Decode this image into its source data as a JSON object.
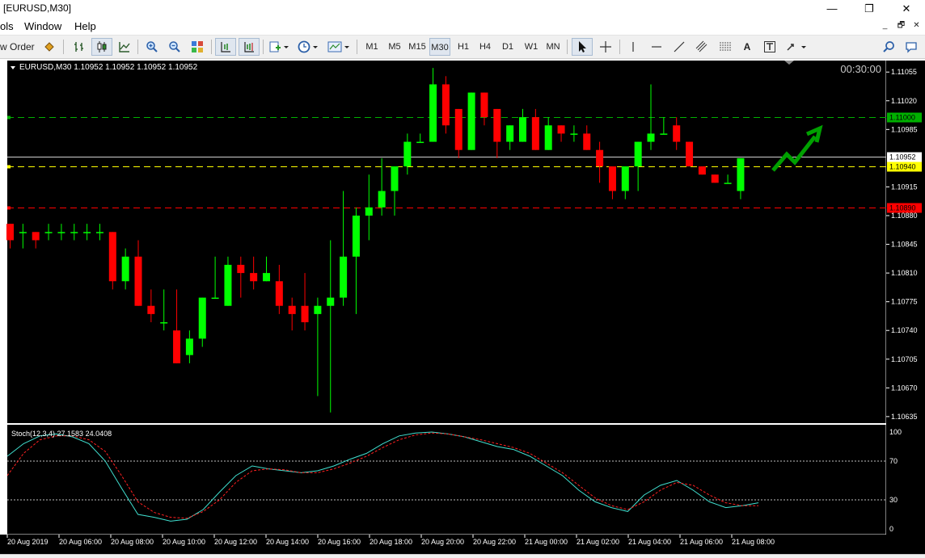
{
  "window": {
    "title": "[EURUSD,M30]"
  },
  "window_controls": [
    "—",
    "❐",
    "✕"
  ],
  "menu": {
    "items": [
      "ols",
      "Window",
      "Help"
    ],
    "mdi_controls": [
      "_",
      "🗗",
      "✕"
    ]
  },
  "toolbar": {
    "new_order_label": "w Order",
    "timeframes": [
      "M1",
      "M5",
      "M15",
      "M30",
      "H1",
      "H4",
      "D1",
      "W1",
      "MN"
    ],
    "selected_timeframe": "M30",
    "text_tool_label": "A"
  },
  "chart": {
    "header": "EURUSD,M30  1.10952 1.10952 1.10952 1.10952",
    "timer": "00:30:00",
    "price_labels": [
      "1.11055",
      "1.11020",
      "1.10985",
      "1.10915",
      "1.10880",
      "1.10845",
      "1.10810",
      "1.10775",
      "1.10740",
      "1.10705",
      "1.10670",
      "1.10635"
    ],
    "price_label_values": [
      1.11055,
      1.1102,
      1.10985,
      1.10915,
      1.1088,
      1.10845,
      1.1081,
      1.10775,
      1.1074,
      1.10705,
      1.1067,
      1.10635
    ],
    "price_range": [
      1.10627,
      1.11069
    ],
    "levels": [
      {
        "label": "1.11000",
        "value": 1.11,
        "color": "#00b000",
        "bg": "#00b000",
        "fg": "#000000"
      },
      {
        "label": "1.10952",
        "value": 1.10952,
        "color": "#d0d0d0",
        "bg": "#ffffff",
        "fg": "#000000"
      },
      {
        "label": "1.10940",
        "value": 1.1094,
        "color": "#ffff00",
        "bg": "#ffff00",
        "fg": "#000000"
      },
      {
        "label": "1.10890",
        "value": 1.1089,
        "color": "#ff0000",
        "bg": "#ff0000",
        "fg": "#000000"
      }
    ],
    "time_labels": [
      "20 Aug 2019",
      "20 Aug 06:00",
      "20 Aug 08:00",
      "20 Aug 10:00",
      "20 Aug 12:00",
      "20 Aug 14:00",
      "20 Aug 16:00",
      "20 Aug 18:00",
      "20 Aug 20:00",
      "20 Aug 22:00",
      "21 Aug 00:00",
      "21 Aug 02:00",
      "21 Aug 04:00",
      "21 Aug 06:00",
      "21 Aug 08:00"
    ],
    "bull_color": "#00ff00",
    "bear_color": "#ff0000",
    "background": "#000000",
    "candles": [
      [
        1.1087,
        1.1087,
        1.1084,
        1.1085
      ],
      [
        1.1086,
        1.1087,
        1.1084,
        1.1086
      ],
      [
        1.1086,
        1.1086,
        1.1084,
        1.1085
      ],
      [
        1.1086,
        1.1087,
        1.1085,
        1.1086
      ],
      [
        1.1086,
        1.1087,
        1.1085,
        1.1086
      ],
      [
        1.1086,
        1.1087,
        1.1085,
        1.1086
      ],
      [
        1.1086,
        1.1087,
        1.1085,
        1.1086
      ],
      [
        1.1086,
        1.1087,
        1.1085,
        1.1086
      ],
      [
        1.1086,
        1.1086,
        1.1079,
        1.108
      ],
      [
        1.108,
        1.1084,
        1.1079,
        1.1083
      ],
      [
        1.1083,
        1.1085,
        1.1077,
        1.1077
      ],
      [
        1.1077,
        1.1079,
        1.1075,
        1.1076
      ],
      [
        1.1075,
        1.1079,
        1.1074,
        1.1075
      ],
      [
        1.1074,
        1.1079,
        1.107,
        1.107
      ],
      [
        1.1071,
        1.1074,
        1.107,
        1.1073
      ],
      [
        1.1073,
        1.1078,
        1.1072,
        1.1078
      ],
      [
        1.1078,
        1.1083,
        1.1078,
        1.1078
      ],
      [
        1.1077,
        1.1083,
        1.1077,
        1.1082
      ],
      [
        1.1082,
        1.1083,
        1.1078,
        1.1081
      ],
      [
        1.1081,
        1.1083,
        1.1079,
        1.108
      ],
      [
        1.108,
        1.1083,
        1.108,
        1.1081
      ],
      [
        1.108,
        1.1082,
        1.1076,
        1.1077
      ],
      [
        1.1077,
        1.1078,
        1.1074,
        1.1076
      ],
      [
        1.1077,
        1.1081,
        1.1074,
        1.1075
      ],
      [
        1.1076,
        1.1078,
        1.1066,
        1.1077
      ],
      [
        1.1077,
        1.1085,
        1.1064,
        1.1078
      ],
      [
        1.1078,
        1.1091,
        1.1077,
        1.1083
      ],
      [
        1.1083,
        1.1089,
        1.1076,
        1.1088
      ],
      [
        1.1088,
        1.1093,
        1.1085,
        1.1089
      ],
      [
        1.1089,
        1.1095,
        1.1088,
        1.1091
      ],
      [
        1.1091,
        1.1094,
        1.1088,
        1.1094
      ],
      [
        1.1094,
        1.1098,
        1.1093,
        1.1097
      ],
      [
        1.1097,
        1.1098,
        1.1097,
        1.1097
      ],
      [
        1.1097,
        1.1106,
        1.1097,
        1.1104
      ],
      [
        1.1104,
        1.1105,
        1.1098,
        1.1099
      ],
      [
        1.1101,
        1.1101,
        1.1095,
        1.1096
      ],
      [
        1.1096,
        1.1103,
        1.1096,
        1.1103
      ],
      [
        1.1103,
        1.1103,
        1.1099,
        1.11
      ],
      [
        1.1101,
        1.1101,
        1.1095,
        1.1097
      ],
      [
        1.1097,
        1.1099,
        1.1096,
        1.1099
      ],
      [
        1.1097,
        1.1101,
        1.1097,
        1.11
      ],
      [
        1.11,
        1.1101,
        1.1096,
        1.1096
      ],
      [
        1.1096,
        1.11,
        1.1096,
        1.1099
      ],
      [
        1.1099,
        1.1099,
        1.1097,
        1.1098
      ],
      [
        1.1098,
        1.1099,
        1.1097,
        1.1098
      ],
      [
        1.1098,
        1.1099,
        1.1096,
        1.1096
      ],
      [
        1.1096,
        1.1097,
        1.1092,
        1.1094
      ],
      [
        1.1094,
        1.1094,
        1.109,
        1.1091
      ],
      [
        1.1091,
        1.1094,
        1.109,
        1.1094
      ],
      [
        1.1094,
        1.1097,
        1.1091,
        1.1097
      ],
      [
        1.1097,
        1.1104,
        1.1096,
        1.1098
      ],
      [
        1.1098,
        1.11,
        1.1098,
        1.1098
      ],
      [
        1.1099,
        1.11,
        1.1096,
        1.1097
      ],
      [
        1.1097,
        1.1097,
        1.1094,
        1.1094
      ],
      [
        1.1094,
        1.1094,
        1.1093,
        1.1093
      ],
      [
        1.1093,
        1.1093,
        1.1092,
        1.1092
      ],
      [
        1.1092,
        1.1093,
        1.1092,
        1.1092
      ],
      [
        1.1091,
        1.1095,
        1.109,
        1.1095
      ]
    ],
    "stoch": {
      "label": "Stoch(12,3,4) 27.1583 24.0408",
      "levels": [
        100,
        70,
        30,
        0
      ],
      "level_labels": [
        "100",
        "70",
        "30",
        "0"
      ],
      "main_color": "#40e0d0",
      "signal_color": "#ff2020",
      "main": [
        75,
        88,
        96,
        98,
        95,
        88,
        70,
        42,
        15,
        12,
        8,
        10,
        20,
        38,
        55,
        65,
        62,
        60,
        58,
        60,
        65,
        72,
        78,
        88,
        96,
        99,
        100,
        98,
        95,
        90,
        85,
        82,
        75,
        65,
        55,
        40,
        28,
        22,
        18,
        35,
        45,
        50,
        40,
        28,
        22,
        24,
        27
      ],
      "signal": [
        55,
        78,
        92,
        96,
        96,
        92,
        80,
        55,
        28,
        17,
        12,
        11,
        18,
        30,
        48,
        60,
        62,
        61,
        58,
        58,
        62,
        68,
        75,
        84,
        92,
        97,
        99,
        98,
        95,
        92,
        88,
        84,
        78,
        68,
        58,
        45,
        32,
        24,
        20,
        28,
        40,
        48,
        45,
        35,
        27,
        24,
        24
      ]
    }
  }
}
